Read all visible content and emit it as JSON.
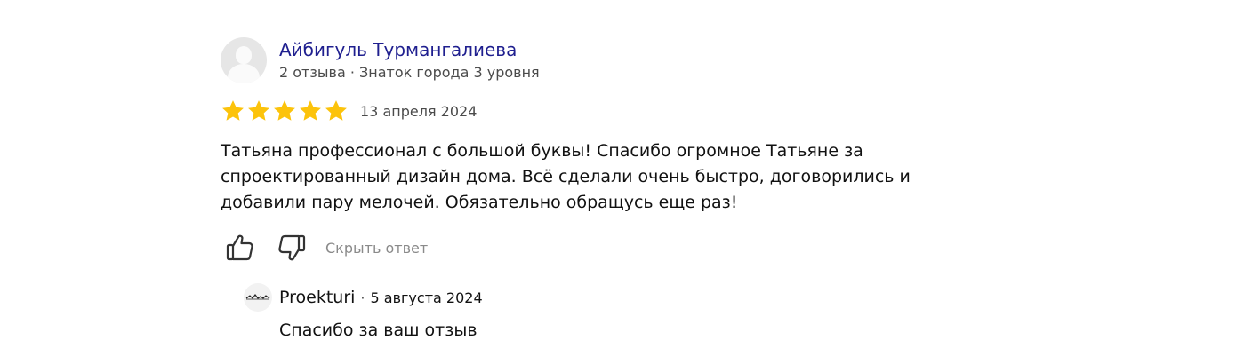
{
  "review": {
    "author": {
      "name": "Айбигуль Турмангалиева",
      "meta": "2 отзыва · Знаток города 3 уровня",
      "avatar_icon": "default-user-avatar-icon"
    },
    "rating": 5,
    "rating_max": 5,
    "star_color": "#fcc30b",
    "date": "13 апреля 2024",
    "text": "Татьяна профессионал с большой буквы! Спасибо огромное Татьяне за спроектированный дизайн дома. Всё сделали очень быстро, договорились и добавили пару мелочей. Обязательно обращусь еще раз!",
    "actions": {
      "like_icon": "thumbs-up-icon",
      "dislike_icon": "thumbs-down-icon",
      "hide_answer_label": "Скрыть ответ"
    },
    "reply": {
      "name": "Proekturi",
      "separator": "·",
      "date": "5 августа 2024",
      "text": "Спасибо за ваш отзыв",
      "logo_icon": "business-logo-icon"
    }
  },
  "colors": {
    "author_name": "#1f1f8f",
    "muted": "#8a8a8a"
  }
}
